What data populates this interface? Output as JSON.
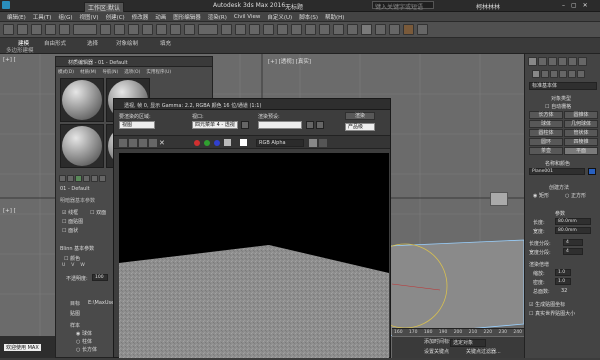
{
  "titlebar": {
    "workspace": "工作区:默认",
    "app_title": "Autodesk 3ds Max 2016",
    "doc_title": "无标题",
    "search_placeholder": "键入关键字或短语",
    "user": "柯林林林"
  },
  "menu": [
    "编辑(E)",
    "工具(T)",
    "组(G)",
    "视图(V)",
    "创建(C)",
    "修改器",
    "动画",
    "图形编辑器",
    "渲染(R)",
    "Civil View",
    "自定义(U)",
    "脚本(S)",
    "帮助(H)"
  ],
  "ribbon": {
    "tabs": [
      "建模",
      "自由形式",
      "选择",
      "对象绘制",
      "填充"
    ],
    "sub": "多边形建模"
  },
  "viewport": {
    "label_top": "[+] [透视] [真实]",
    "label_left_top": "[+] [",
    "label_left_mid": "[+] [",
    "view_cube": "",
    "ruler": [
      "160",
      "170",
      "180",
      "190",
      "200",
      "210",
      "220",
      "230",
      "240"
    ]
  },
  "material_editor": {
    "title": "材质编辑器 - 01 - Default",
    "menu": [
      "模式(D)",
      "材质(M)",
      "导航(N)",
      "选项(O)",
      "实用程序(U)"
    ],
    "shader_label": "明暗器基本参数",
    "params": [
      {
        "label": "线框",
        "checked": true
      },
      {
        "label": "双面",
        "checked": false
      },
      {
        "label": "面贴图",
        "checked": false
      },
      {
        "label": "面状",
        "checked": false
      }
    ],
    "name_field": "01 - Default",
    "ambient_label": "环境光:",
    "diffuse_label": "漫反射:",
    "specular_label": "高光反射:",
    "opacity_label": "不透明度:",
    "opacity_value": "100",
    "self_illum": "自发光",
    "blinn": "Blinn 基本参数",
    "color_check": "颜色",
    "uv_labels": [
      "U",
      "V",
      "W"
    ],
    "bottom_text": "目标",
    "bottom_value": "E:\\MaxUser",
    "sample_label": "样本",
    "sample_options": [
      "球体",
      "柱体",
      "长方体"
    ],
    "misc_label": "贴图",
    "bump_label": "凹凸",
    "extra": "其他"
  },
  "render_frame": {
    "title": "透视, 帧 0, 显示 Gamma: 2.2, RGBA 颜色 16 位/通道 (1:1)",
    "area_label": "要渲染的区域:",
    "area_value": "视图",
    "viewport_label": "视口:",
    "viewport_value": "四元菜单 4 - 透视",
    "preset_label": "渲染预设:",
    "preset_value": "",
    "render_button": "渲染",
    "mode_value": "产品级",
    "channel_value": "RGB Alpha",
    "swatch_colors": [
      "#d03030",
      "#30a030",
      "#3040d0"
    ]
  },
  "command_panel": {
    "object_type_header": "对象类型",
    "autogrid": "自动栅格",
    "buttons": [
      "长方体",
      "圆锥体",
      "球体",
      "几何球体",
      "圆柱体",
      "管状体",
      "圆环",
      "四棱锥",
      "茶壶",
      "平面"
    ],
    "primitive_dropdown": "标准基本体",
    "name_color_header": "名称和颜色",
    "name_value": "Plane001",
    "create_method_header": "创建方法",
    "create_methods": [
      "矩形",
      "正方形"
    ],
    "params_header": "参数",
    "length_label": "长度:",
    "length_value": "80.0mm",
    "width_label": "宽度:",
    "width_value": "80.0mm",
    "length_seg_label": "长度分段:",
    "length_seg_value": "4",
    "width_seg_label": "宽度分段:",
    "width_seg_value": "4",
    "render_mult_header": "渲染倍增",
    "scale_label": "缩放:",
    "scale_value": "1.0",
    "density_label": "密度:",
    "density_value": "1.0",
    "total_faces_label": "总面数:",
    "total_faces_value": "32",
    "gen_map_coords": "生成贴图坐标",
    "real_world_size": "真实世界贴图大小"
  },
  "status": {
    "left_text": "欢迎使用",
    "left_value": "MAX",
    "add_time_tag": "添加时间标记",
    "set_key": "设置关键点",
    "selected": "选定对象",
    "key_filter": "关键点过滤器..."
  }
}
